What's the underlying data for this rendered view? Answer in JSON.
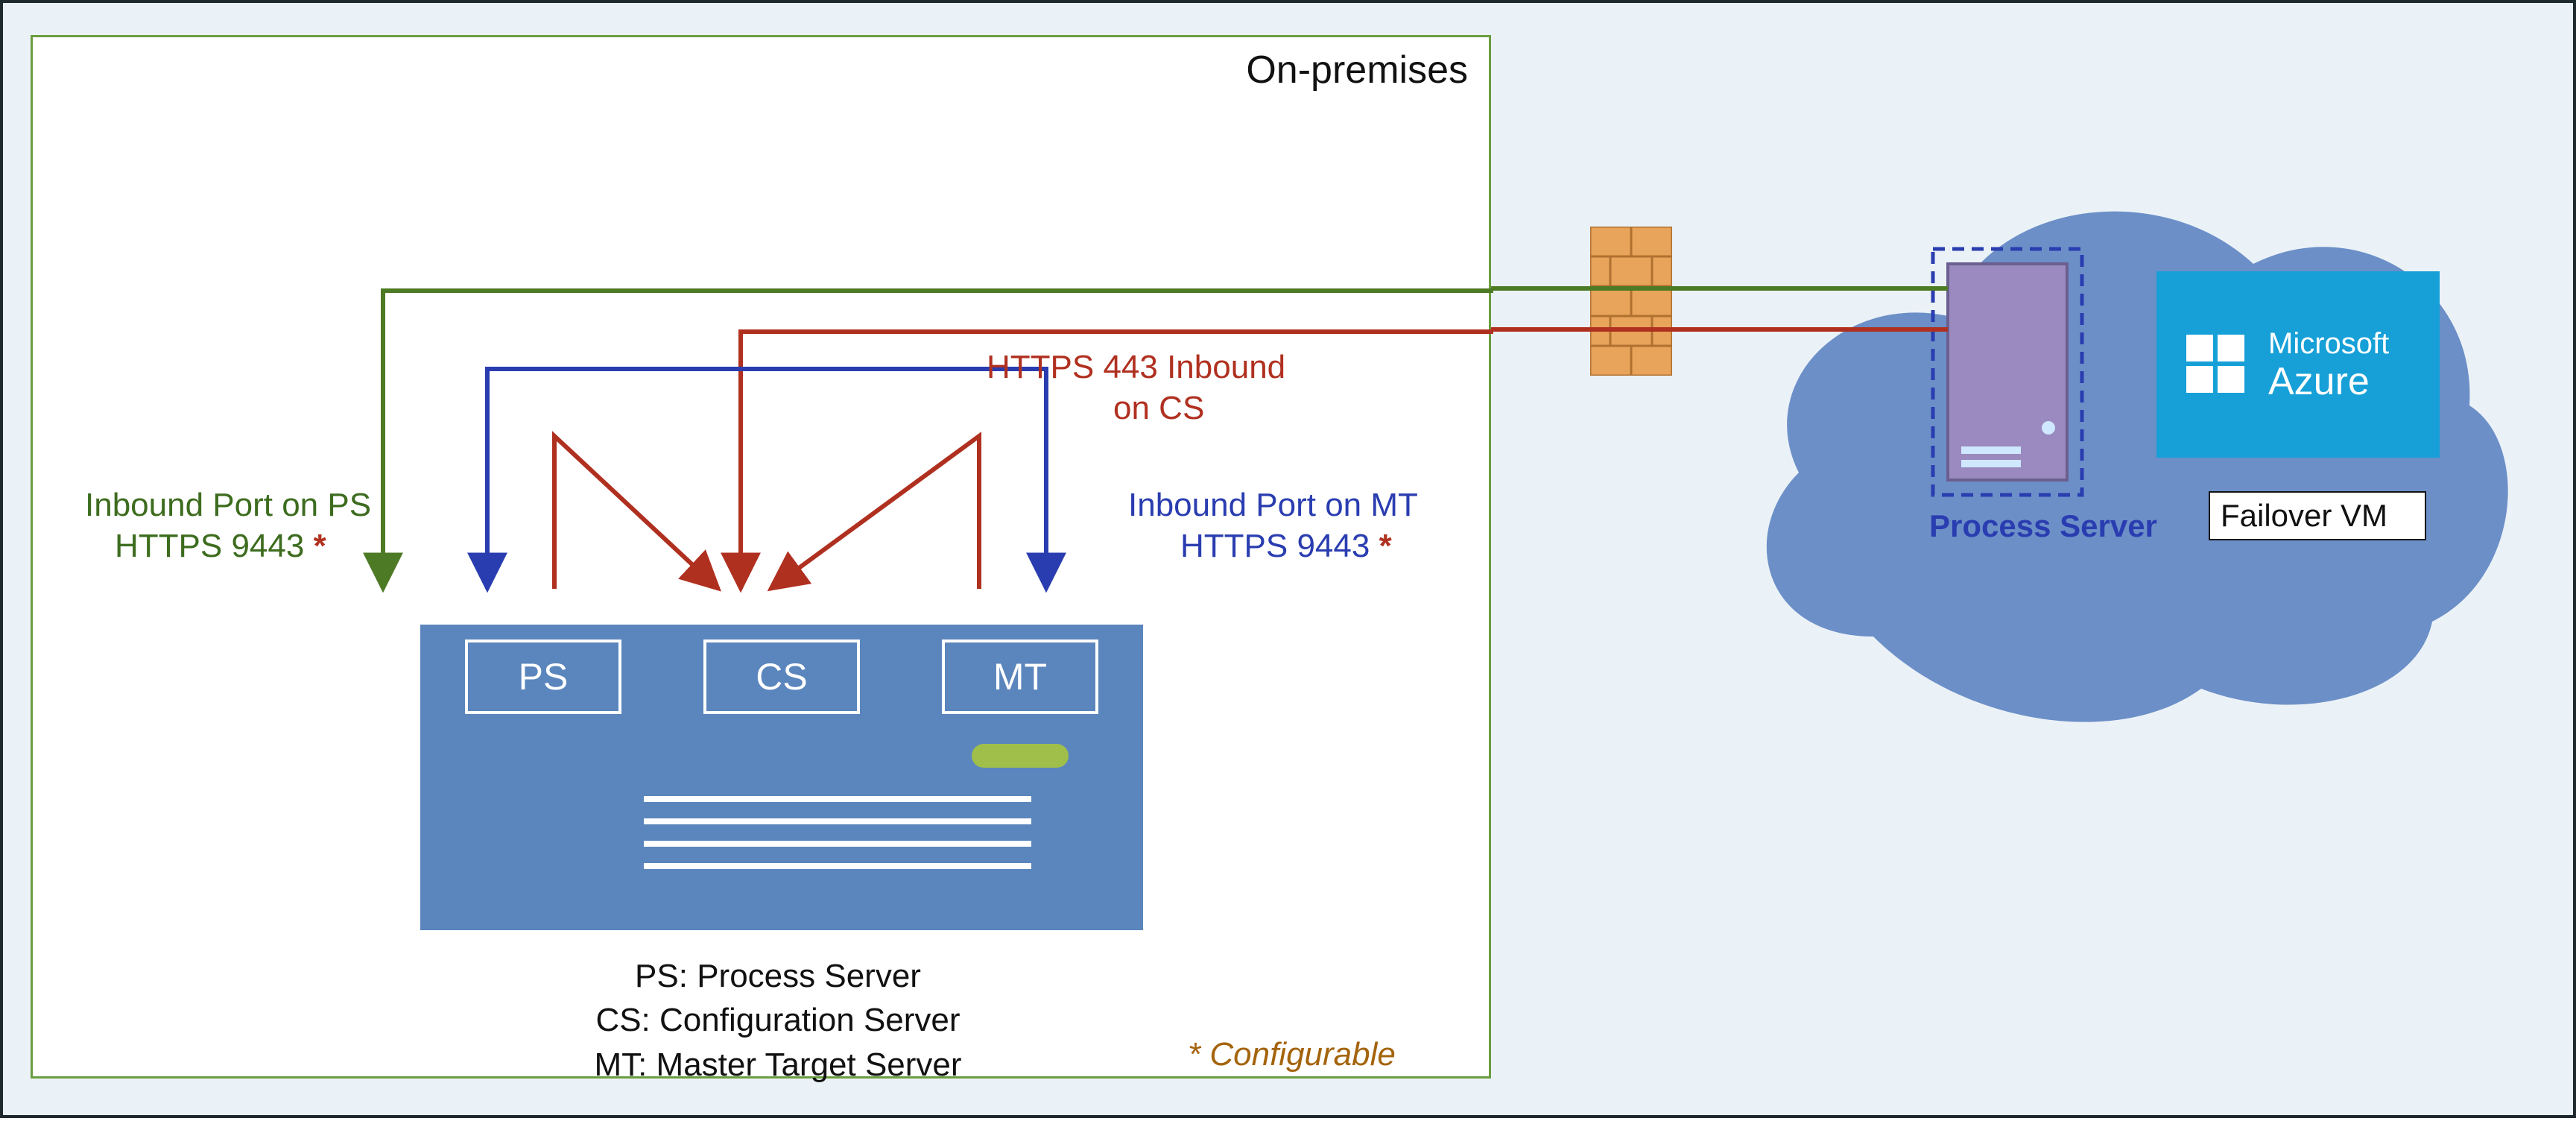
{
  "onprem": {
    "title": "On-premises"
  },
  "server": {
    "ps": "PS",
    "cs": "CS",
    "mt": "MT"
  },
  "legend": {
    "l1": "PS: Process Server",
    "l2": "CS: Configuration Server",
    "l3": "MT: Master Target Server"
  },
  "note": {
    "configurable": "* Configurable"
  },
  "labels": {
    "ps_line1": "Inbound Port on PS",
    "ps_line2": "HTTPS 9443 ",
    "cs_line1": "HTTPS 443 Inbound",
    "cs_line2": "on CS",
    "mt_line1": "Inbound Port on MT",
    "mt_line2": "HTTPS 9443 "
  },
  "cloud": {
    "process_server": "Process Server",
    "failover": "Failover VM",
    "azure": "Microsoft Azure"
  },
  "colors": {
    "green": "#4d7a24",
    "red": "#b03020",
    "blue": "#2a3db0",
    "server": "#5b86bd",
    "cloud": "#6c8fc8",
    "azure": "#16a0d7"
  }
}
